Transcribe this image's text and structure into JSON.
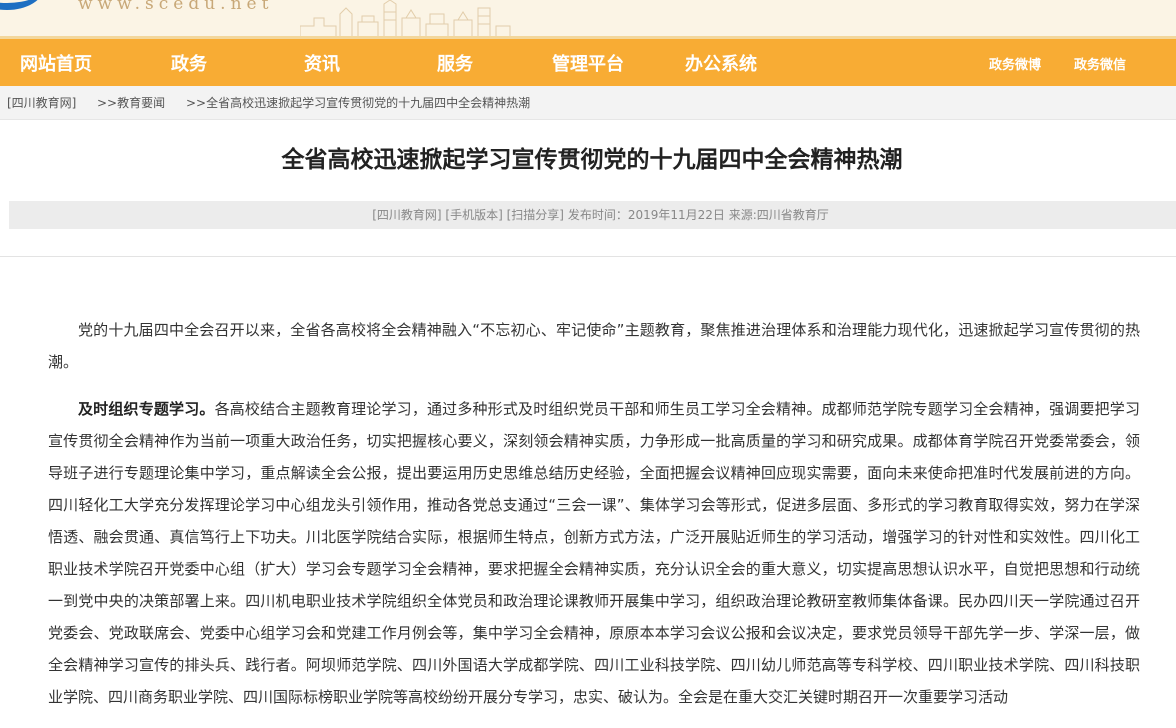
{
  "header": {
    "site_url": "www.scedu.net",
    "brand_color": "#1e6fc2"
  },
  "nav": {
    "bg_color": "#f8ac34",
    "items": [
      {
        "label": "网站首页"
      },
      {
        "label": "政务"
      },
      {
        "label": "资讯"
      },
      {
        "label": "服务"
      },
      {
        "label": "管理平台"
      },
      {
        "label": "办公系统"
      }
    ],
    "right_links": [
      {
        "label": "政务微博"
      },
      {
        "label": "政务微信"
      }
    ]
  },
  "breadcrumb": {
    "home": "[四川教育网]",
    "section": ">>教育要闻",
    "current": ">>全省高校迅速掀起学习宣传贯彻党的十九届四中全会精神热潮"
  },
  "article": {
    "title": "全省高校迅速掀起学习宣传贯彻党的十九届四中全会精神热潮",
    "meta": {
      "site": "[四川教育网]",
      "mobile": "[手机版本]",
      "scan_share": "[扫描分享]",
      "publish_time": "发布时间：2019年11月22日",
      "source": "来源:四川省教育厅"
    },
    "paragraphs": [
      {
        "lead": "",
        "text": "党的十九届四中全会召开以来，全省各高校将全会精神融入“不忘初心、牢记使命”主题教育，聚焦推进治理体系和治理能力现代化，迅速掀起学习宣传贯彻的热潮。"
      },
      {
        "lead": "及时组织专题学习。",
        "text": "各高校结合主题教育理论学习，通过多种形式及时组织党员干部和师生员工学习全会精神。成都师范学院专题学习全会精神，强调要把学习宣传贯彻全会精神作为当前一项重大政治任务，切实把握核心要义，深刻领会精神实质，力争形成一批高质量的学习和研究成果。成都体育学院召开党委常委会，领导班子进行专题理论集中学习，重点解读全会公报，提出要运用历史思维总结历史经验，全面把握会议精神回应现实需要，面向未来使命把准时代发展前进的方向。四川轻化工大学充分发挥理论学习中心组龙头引领作用，推动各党总支通过“三会一课”、集体学习会等形式，促进多层面、多形式的学习教育取得实效，努力在学深悟透、融会贯通、真信笃行上下功夫。川北医学院结合实际，根据师生特点，创新方式方法，广泛开展贴近师生的学习活动，增强学习的针对性和实效性。四川化工职业技术学院召开党委中心组（扩大）学习会专题学习全会精神，要求把握全会精神实质，充分认识全会的重大意义，切实提高思想认识水平，自觉把思想和行动统一到党中央的决策部署上来。四川机电职业技术学院组织全体党员和政治理论课教师开展集中学习，组织政治理论教研室教师集体备课。民办四川天一学院通过召开党委会、党政联席会、党委中心组学习会和党建工作月例会等，集中学习全会精神，原原本本学习会议公报和会议决定，要求党员领导干部先学一步、学深一层，做全会精神学习宣传的排头兵、践行者。阿坝师范学院、四川外国语大学成都学院、四川工业科技学院、四川幼儿师范高等专科学校、四川职业技术学院、四川科技职业学院、四川商务职业学院、四川国际标榜职业学院等高校纷纷开展分专学习，忠实、破认为。全会是在重大交汇关键时期召开一次重要学习活动"
      }
    ]
  }
}
